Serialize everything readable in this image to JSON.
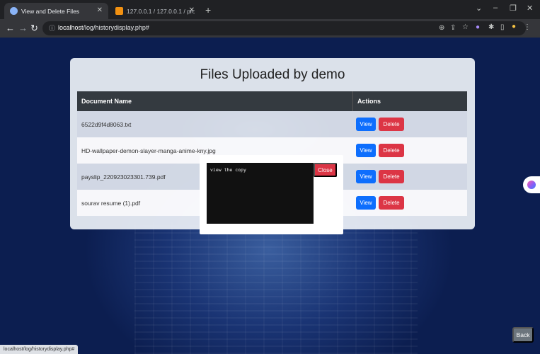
{
  "browser": {
    "tabs": [
      {
        "title": "View and Delete Files",
        "active": true
      },
      {
        "title": "127.0.0.1 / 127.0.0.1 / project / ...",
        "active": false
      }
    ],
    "url_host": "localhost",
    "url_path": "/log/historydisplay.php#",
    "status_url": "localhost/log/historydisplay.php#"
  },
  "page": {
    "title": "Files Uploaded by demo",
    "columns": [
      "Document Name",
      "Actions"
    ],
    "files": [
      {
        "name": "6522d9f4d8063.txt"
      },
      {
        "name": "HD-wallpaper-demon-slayer-manga-anime-kny.jpg"
      },
      {
        "name": "payslip_220923023301.739.pdf"
      },
      {
        "name": "sourav resume (1).pdf"
      }
    ],
    "view_label": "View",
    "delete_label": "Delete",
    "back_label": "Back"
  },
  "modal": {
    "content": "view the copy",
    "close_label": "Close"
  },
  "colors": {
    "primary": "#0d6efd",
    "danger": "#dc3545",
    "header": "#343a40",
    "secondary": "#6c757d"
  }
}
